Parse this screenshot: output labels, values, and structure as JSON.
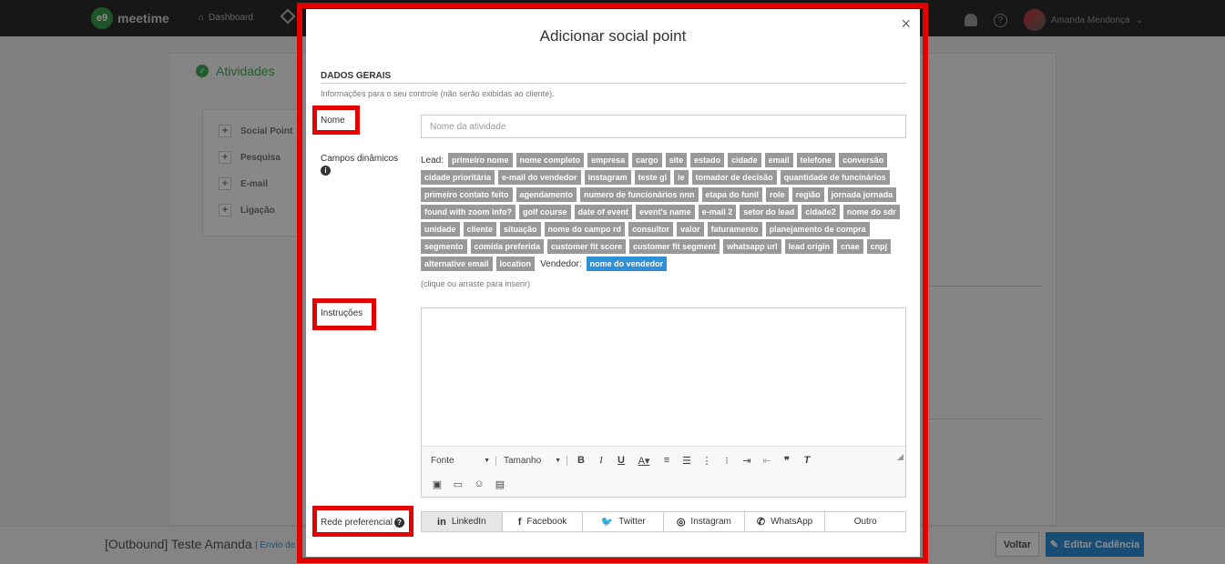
{
  "app": {
    "logo_text": "meetime",
    "logo_mark": "e9",
    "nav_dashboard": "Dashboard",
    "user_name": "Amanda Mendonça",
    "help_glyph": "?"
  },
  "background": {
    "section_title": "Atividades",
    "items": [
      {
        "label": "Social Point"
      },
      {
        "label": "Pesquisa"
      },
      {
        "label": "E-mail"
      },
      {
        "label": "Ligação"
      }
    ],
    "cadence_title": "[Outbound] Teste Amanda",
    "cadence_sub": "| Envio de",
    "btn_voltar": "Voltar",
    "btn_editar": "Editar Cadência"
  },
  "modal": {
    "title": "Adicionar social point",
    "close_glyph": "×",
    "section_title": "DADOS GERAIS",
    "section_sub": "Informações para o seu controle (não serão exibidas ao cliente).",
    "nome_label": "Nome",
    "nome_placeholder": "Nome da atividade",
    "campos_label": "Campos dinâmicos",
    "lead_label": "Lead:",
    "vendedor_label": "Vendedor:",
    "lead_tags": [
      "primeiro nome",
      "nome completo",
      "empresa",
      "cargo",
      "site",
      "estado",
      "cidade",
      "email",
      "telefone",
      "conversão",
      "cidade prioritária",
      "e-mail do vendedor",
      "instagram",
      "teste gl",
      "ie",
      "tomador de decisão",
      "quantidade de funcinários",
      "primeiro contato feito",
      "agendamento",
      "numero de funcionários nnn",
      "etapa do funil",
      "role",
      "região",
      "jornada jornada",
      "found with zoom info?",
      "golf course",
      "date of event",
      "event's name",
      "e-mail 2",
      "setor do lead",
      "cidade2",
      "nome do sdr",
      "unidade",
      "cliente",
      "situação",
      "nome do campo rd",
      "consultor",
      "valor",
      "faturamento",
      "planejamento de compra",
      "segmento",
      "comida preferida",
      "customer fit score",
      "customer fit segment",
      "whatsapp url",
      "lead origin",
      "cnae",
      "cnpj",
      "alternative email",
      "location"
    ],
    "vendedor_tag": "nome do vendedor",
    "tags_hint": "(clique ou arraste para inserir)",
    "instrucoes_label": "Instruções",
    "toolbar": {
      "font_label": "Fonte",
      "size_label": "Tamanho"
    },
    "rede_label": "Rede preferencial",
    "social_options": [
      {
        "label": "LinkedIn",
        "icon": "linkedin-icon",
        "glyph": "in",
        "active": true
      },
      {
        "label": "Facebook",
        "icon": "facebook-icon",
        "glyph": "f",
        "active": false
      },
      {
        "label": "Twitter",
        "icon": "twitter-icon",
        "glyph": "🐦",
        "active": false
      },
      {
        "label": "Instagram",
        "icon": "instagram-icon",
        "glyph": "◎",
        "active": false
      },
      {
        "label": "WhatsApp",
        "icon": "whatsapp-icon",
        "glyph": "✆",
        "active": false
      },
      {
        "label": "Outro",
        "icon": "",
        "glyph": "",
        "active": false
      }
    ]
  },
  "colors": {
    "highlight": "#e50000",
    "tag_gray": "#999999",
    "tag_blue": "#2d8fd5",
    "brand_green": "#3aaa55"
  }
}
